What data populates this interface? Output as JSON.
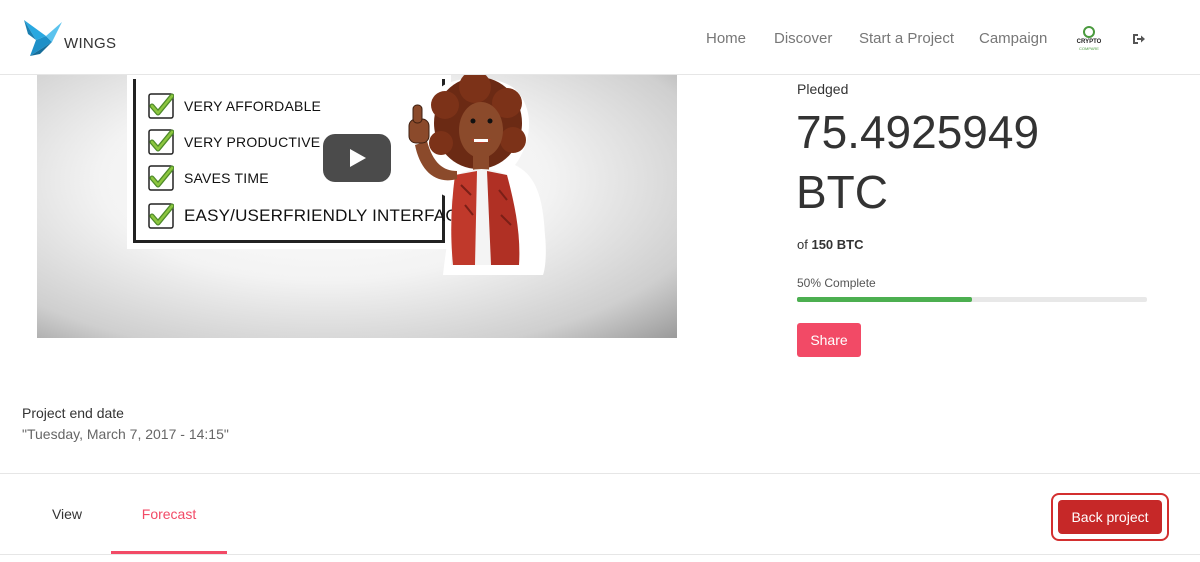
{
  "header": {
    "logo_text": "WINGS",
    "nav": [
      {
        "label": "Home"
      },
      {
        "label": "Discover"
      },
      {
        "label": "Start a Project"
      },
      {
        "label": "Campaign"
      }
    ],
    "partner_logo_text": "CRYPTO",
    "partner_logo_subtext": "COMPARE",
    "signout_icon": "sign-out-icon"
  },
  "video": {
    "checklist": [
      {
        "label": "VERY AFFORDABLE"
      },
      {
        "label": "VERY PRODUCTIVE"
      },
      {
        "label": "SAVES TIME"
      },
      {
        "label": "EASY/USERFRIENDLY INTERFAC"
      }
    ],
    "play_icon": "play-icon"
  },
  "funding": {
    "pledged_label": "Pledged",
    "pledged_amount": "75.4925949 BTC",
    "goal_prefix": "of",
    "goal_amount": "150 BTC",
    "progress_text": "50% Complete",
    "progress_fraction": 0.5,
    "progress_color": "#4caf50",
    "share_label": "Share"
  },
  "project": {
    "end_date_label": "Project end date",
    "end_date_value": "\"Tuesday, March 7, 2017 - 14:15\""
  },
  "tabs": {
    "view_label": "View",
    "forecast_label": "Forecast",
    "back_project_label": "Back project"
  },
  "colors": {
    "accent": "#f24a66",
    "back_button": "#c62828",
    "progress": "#4caf50",
    "logo": "#29a8e0"
  }
}
